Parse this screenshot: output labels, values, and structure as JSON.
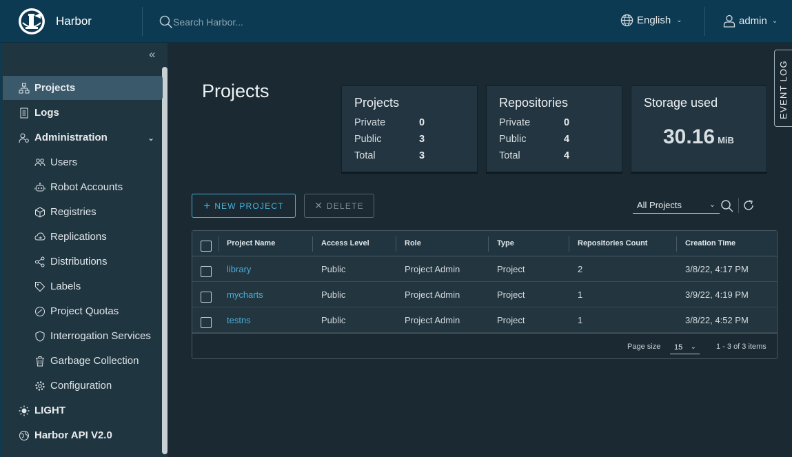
{
  "header": {
    "app_name": "Harbor",
    "search_placeholder": "Search Harbor...",
    "language": "English",
    "user": "admin"
  },
  "sidebar": {
    "collapse_icon": "double-chevron-left-icon",
    "items": [
      {
        "label": "Projects",
        "icon": "projects-icon",
        "active": true
      },
      {
        "label": "Logs",
        "icon": "logs-icon"
      },
      {
        "label": "Administration",
        "icon": "administration-icon",
        "expanded": true
      },
      {
        "label": "Users",
        "icon": "users-icon"
      },
      {
        "label": "Robot Accounts",
        "icon": "robot-icon"
      },
      {
        "label": "Registries",
        "icon": "registries-icon"
      },
      {
        "label": "Replications",
        "icon": "replications-icon"
      },
      {
        "label": "Distributions",
        "icon": "distributions-icon"
      },
      {
        "label": "Labels",
        "icon": "labels-icon"
      },
      {
        "label": "Project Quotas",
        "icon": "quotas-icon"
      },
      {
        "label": "Interrogation Services",
        "icon": "shield-icon"
      },
      {
        "label": "Garbage Collection",
        "icon": "trash-icon"
      },
      {
        "label": "Configuration",
        "icon": "gear-icon"
      },
      {
        "label": "LIGHT",
        "icon": "sun-icon"
      },
      {
        "label": "Harbor API V2.0",
        "icon": "api-icon"
      }
    ]
  },
  "main": {
    "title": "Projects",
    "event_log": "EVENT LOG",
    "cards": {
      "projects": {
        "title": "Projects",
        "private_label": "Private",
        "private": "0",
        "public_label": "Public",
        "public": "3",
        "total_label": "Total",
        "total": "3"
      },
      "repositories": {
        "title": "Repositories",
        "private_label": "Private",
        "private": "0",
        "public_label": "Public",
        "public": "4",
        "total_label": "Total",
        "total": "4"
      },
      "storage": {
        "title": "Storage used",
        "value": "30.16",
        "unit": "MiB"
      }
    },
    "toolbar": {
      "new_project": "NEW PROJECT",
      "delete": "DELETE",
      "filter": "All Projects"
    },
    "table": {
      "columns": [
        "Project Name",
        "Access Level",
        "Role",
        "Type",
        "Repositories Count",
        "Creation Time"
      ],
      "rows": [
        {
          "name": "library",
          "access": "Public",
          "role": "Project Admin",
          "type": "Project",
          "repos": "2",
          "created": "3/8/22, 4:17 PM"
        },
        {
          "name": "mycharts",
          "access": "Public",
          "role": "Project Admin",
          "type": "Project",
          "repos": "1",
          "created": "3/9/22, 4:19 PM"
        },
        {
          "name": "testns",
          "access": "Public",
          "role": "Project Admin",
          "type": "Project",
          "repos": "1",
          "created": "3/8/22, 4:52 PM"
        }
      ],
      "page_size_label": "Page size",
      "page_size": "15",
      "count_text": "1 - 3 of 3 items"
    }
  },
  "colors": {
    "header_bg": "#0c3a52",
    "sidebar_bg": "#1f3540",
    "main_bg": "#1b2a32",
    "accent": "#49afd9"
  }
}
